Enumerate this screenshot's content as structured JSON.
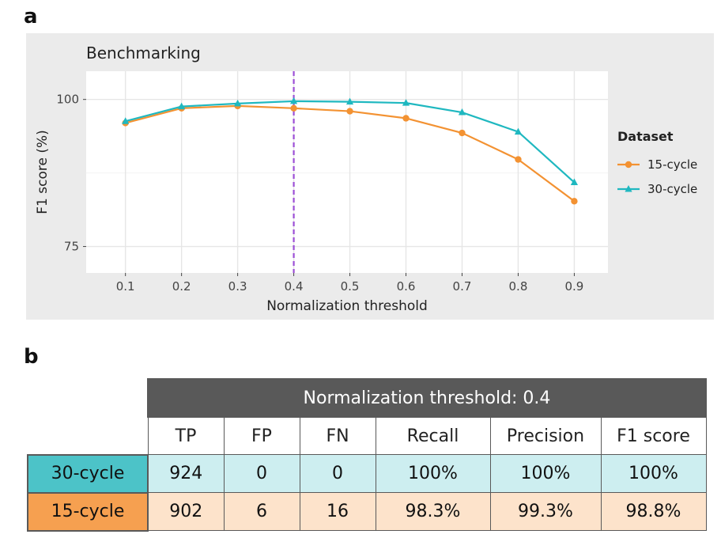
{
  "panels": {
    "a": "a",
    "b": "b"
  },
  "chart_data": {
    "type": "line",
    "title": "Benchmarking",
    "xlabel": "Normalization threshold",
    "ylabel": "F1 score (%)",
    "x": [
      0.1,
      0.2,
      0.3,
      0.4,
      0.5,
      0.6,
      0.7,
      0.8,
      0.9
    ],
    "x_ticks": [
      "0.1",
      "0.2",
      "0.3",
      "0.4",
      "0.5",
      "0.6",
      "0.7",
      "0.8",
      "0.9"
    ],
    "y_ticks": [
      75,
      100
    ],
    "xlim": [
      0.03,
      0.96
    ],
    "ylim": [
      70.5,
      104.8
    ],
    "grid": true,
    "vline": {
      "x": 0.4,
      "color": "#9c4fd6",
      "style": "dashed"
    },
    "legend": {
      "title": "Dataset",
      "placement": "right"
    },
    "series": [
      {
        "name": "15-cycle",
        "color": "#f39232",
        "marker": "circle",
        "values": [
          96.0,
          98.5,
          98.9,
          98.5,
          98.0,
          96.8,
          94.3,
          89.8,
          82.7
        ]
      },
      {
        "name": "30-cycle",
        "color": "#1fb8c0",
        "marker": "triangle",
        "values": [
          96.3,
          98.8,
          99.3,
          99.7,
          99.6,
          99.4,
          97.8,
          94.5,
          85.9
        ]
      }
    ]
  },
  "table": {
    "group_header": "Normalization threshold: 0.4",
    "columns": [
      "TP",
      "FP",
      "FN",
      "Recall",
      "Precision",
      "F1 score"
    ],
    "rows": [
      {
        "label": "30-cycle",
        "cells": [
          "924",
          "0",
          "0",
          "100%",
          "100%",
          "100%"
        ]
      },
      {
        "label": "15-cycle",
        "cells": [
          "902",
          "6",
          "16",
          "98.3%",
          "99.3%",
          "98.8%"
        ]
      }
    ],
    "colors": {
      "row_30_label": "#4cc3c8",
      "row_30_cells": "#cdeef0",
      "row_15_label": "#f6a050",
      "row_15_cells": "#fde3cb",
      "header": "#595959"
    }
  }
}
